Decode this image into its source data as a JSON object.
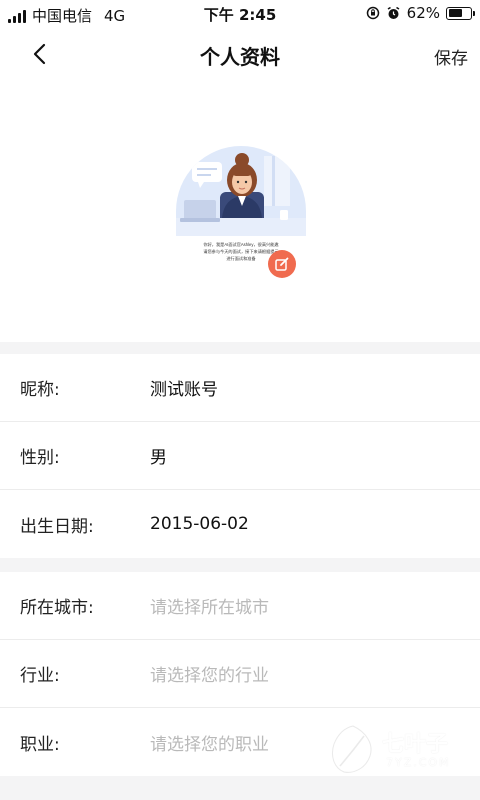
{
  "status_bar": {
    "carrier": "中国电信",
    "network": "4G",
    "time": "下午 2:45",
    "battery": "62%",
    "battery_level": 0.62
  },
  "nav": {
    "title": "个人资料",
    "save_label": "保存",
    "back_icon": "chevron-left-icon"
  },
  "avatar": {
    "caption_line1": "你好，我是AI面试官Ashley，很高兴能邀",
    "caption_line2": "请您参与今天的面试，接下来请根据提示",
    "caption_line3": "进行面试和准备",
    "edit_icon": "edit-icon",
    "edit_color": "#f06b4f"
  },
  "profile_basic": [
    {
      "label": "昵称:",
      "value": "测试账号",
      "placeholder": false
    },
    {
      "label": "性别:",
      "value": "男",
      "placeholder": false
    },
    {
      "label": "出生日期:",
      "value": "2015-06-02",
      "placeholder": false
    }
  ],
  "profile_work": [
    {
      "label": "所在城市:",
      "value": "请选择所在城市",
      "placeholder": true
    },
    {
      "label": "行业:",
      "value": "请选择您的行业",
      "placeholder": true
    },
    {
      "label": "职业:",
      "value": "请选择您的职业",
      "placeholder": true
    }
  ],
  "watermark": {
    "text": "七叶子",
    "sub": "7YZ.COM"
  }
}
